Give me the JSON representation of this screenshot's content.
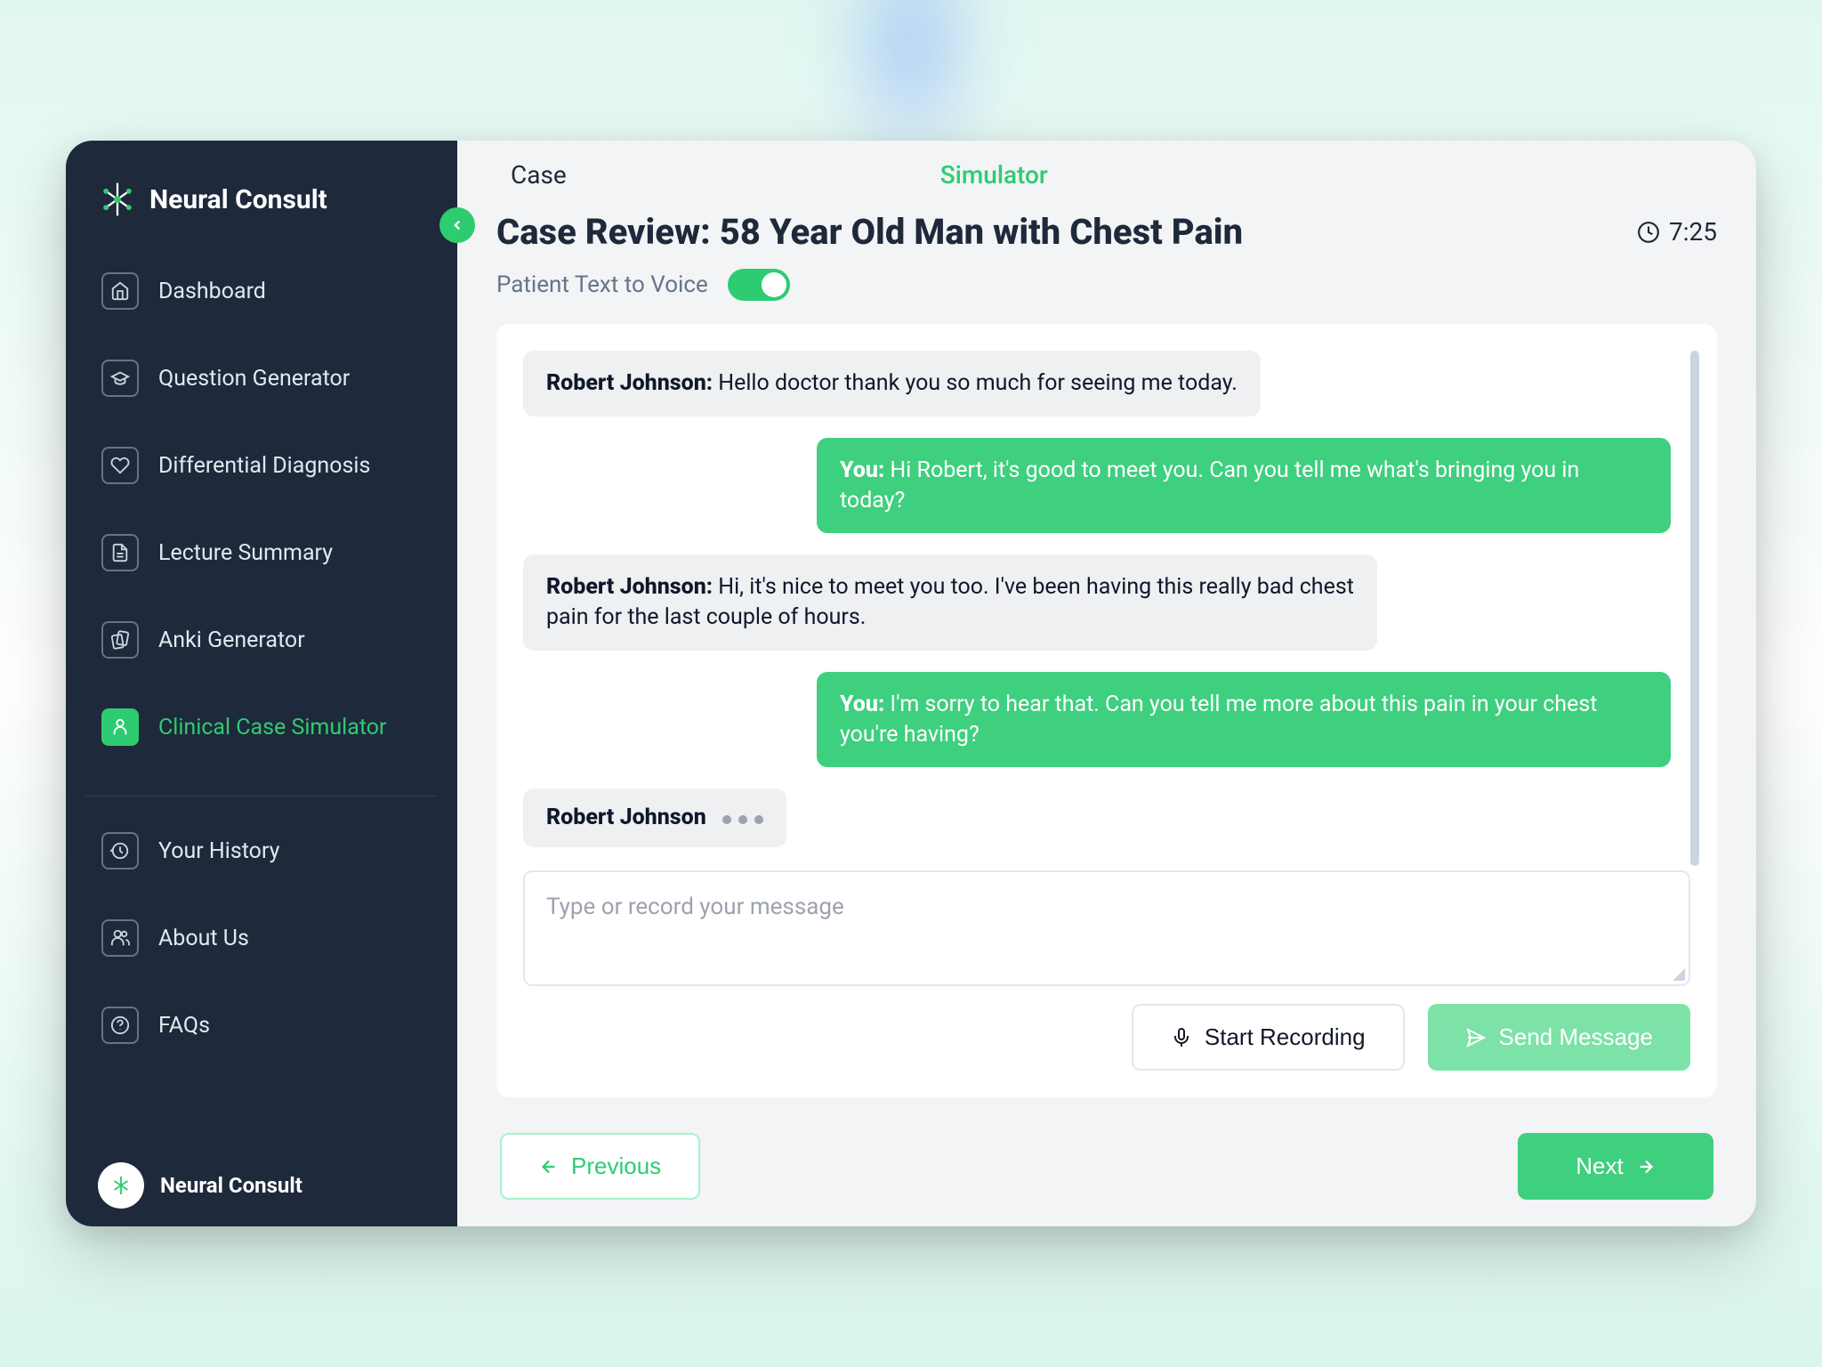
{
  "brand": {
    "name": "Neural Consult",
    "footer": "Neural Consult"
  },
  "sidebar": {
    "items": [
      {
        "label": "Dashboard",
        "name": "sidebar-item-dashboard",
        "icon": "home-icon"
      },
      {
        "label": "Question Generator",
        "name": "sidebar-item-question-gen",
        "icon": "cap-icon"
      },
      {
        "label": "Differential Diagnosis",
        "name": "sidebar-item-diff-dx",
        "icon": "heart-icon"
      },
      {
        "label": "Lecture Summary",
        "name": "sidebar-item-lecture",
        "icon": "doc-icon"
      },
      {
        "label": "Anki Generator",
        "name": "sidebar-item-anki",
        "icon": "cards-icon"
      },
      {
        "label": "Clinical Case Simulator",
        "name": "sidebar-item-simulator",
        "icon": "person-icon",
        "active": true
      }
    ],
    "secondary": [
      {
        "label": "Your History",
        "name": "sidebar-item-history",
        "icon": "history-icon"
      },
      {
        "label": "About Us",
        "name": "sidebar-item-about",
        "icon": "people-icon"
      },
      {
        "label": "FAQs",
        "name": "sidebar-item-faqs",
        "icon": "help-icon"
      }
    ]
  },
  "tabs": {
    "case": "Case",
    "simulator": "Simulator"
  },
  "page": {
    "title": "Case Review: 58 Year Old Man with Chest Pain",
    "timer": "7:25",
    "tts_label": "Patient Text to Voice",
    "tts_on": true
  },
  "chat": {
    "messages": [
      {
        "role": "patient",
        "sender": "Robert Johnson:",
        "text": " Hello doctor thank you so much for seeing me today."
      },
      {
        "role": "user",
        "sender": "You:",
        "text": " Hi Robert, it's good to meet you. Can you tell me what's bringing you in today?"
      },
      {
        "role": "patient",
        "sender": "Robert Johnson:",
        "text": " Hi, it's nice to meet you too. I've been having this really bad chest pain for the last couple of hours."
      },
      {
        "role": "user",
        "sender": "You:",
        "text": " I'm sorry to hear that. Can you tell me more about this pain in your chest you're having?"
      }
    ],
    "typing_sender": "Robert Johnson",
    "input_placeholder": "Type or record your message"
  },
  "buttons": {
    "record": "Start Recording",
    "send": "Send Message",
    "prev": "Previous",
    "next": "Next"
  },
  "colors": {
    "accent": "#2ecc71",
    "sidebar_bg": "#1e293b"
  }
}
